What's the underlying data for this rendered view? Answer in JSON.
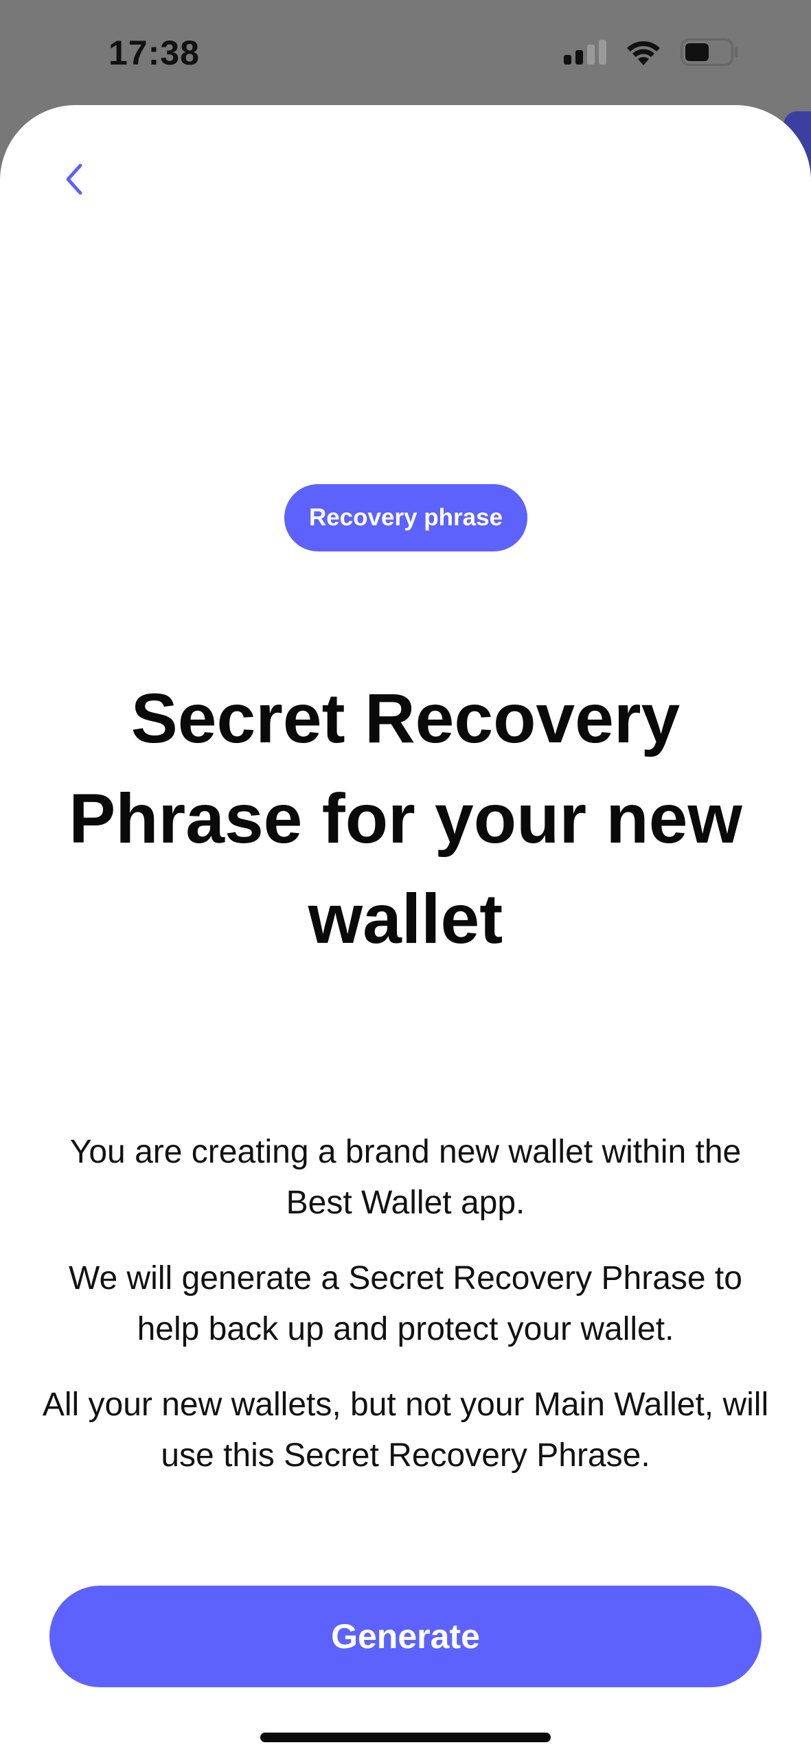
{
  "status_bar": {
    "time": "17:38",
    "icons": [
      "signal-icon",
      "wifi-icon",
      "battery-icon"
    ]
  },
  "navigation": {
    "back_icon": "chevron-left-icon"
  },
  "badge": {
    "label": "Recovery phrase"
  },
  "title": "Secret Recovery Phrase for your new wallet",
  "paragraphs": [
    "You are creating a brand new wallet within the Best Wallet app.",
    "We will generate a Secret Recovery Phrase to help back up and protect your wallet.",
    "All your new wallets, but not your Main Wallet, will use this Secret Recovery Phrase."
  ],
  "primary_button": {
    "label": "Generate"
  },
  "colors": {
    "accent": "#5c62fb",
    "status_bar_background": "#787878",
    "sheet_background": "#ffffff",
    "text": "#0a0a0a"
  }
}
